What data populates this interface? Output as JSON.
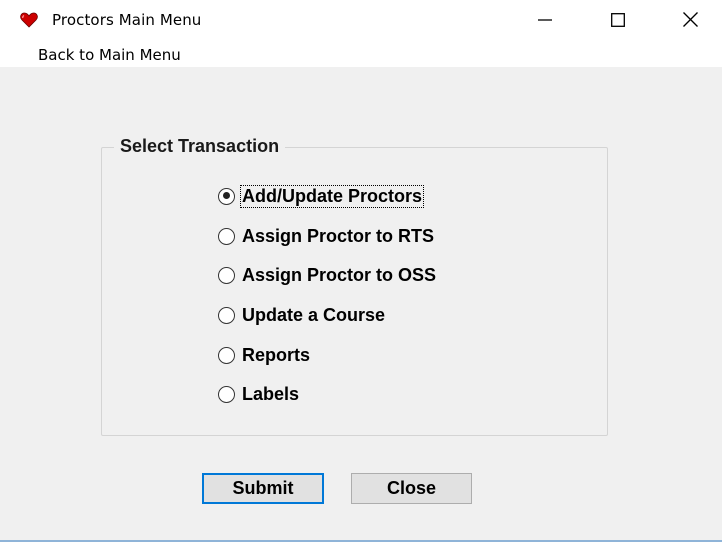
{
  "window": {
    "title": "Proctors Main Menu",
    "icon": "heart-icon",
    "accent_color": "#cc0000",
    "controls": [
      "minimize-icon",
      "maximize-icon",
      "close-icon"
    ]
  },
  "menu": {
    "items": [
      {
        "label": "Back to Main Menu"
      }
    ]
  },
  "transaction_group": {
    "label": "Select Transaction",
    "options": [
      {
        "label": "Add/Update Proctors",
        "selected": true
      },
      {
        "label": "Assign Proctor to RTS",
        "selected": false
      },
      {
        "label": "Assign Proctor to OSS",
        "selected": false
      },
      {
        "label": "Update a Course",
        "selected": false
      },
      {
        "label": "Reports",
        "selected": false
      },
      {
        "label": "Labels",
        "selected": false
      }
    ]
  },
  "buttons": {
    "submit_label": "Submit",
    "close_label": "Close"
  }
}
